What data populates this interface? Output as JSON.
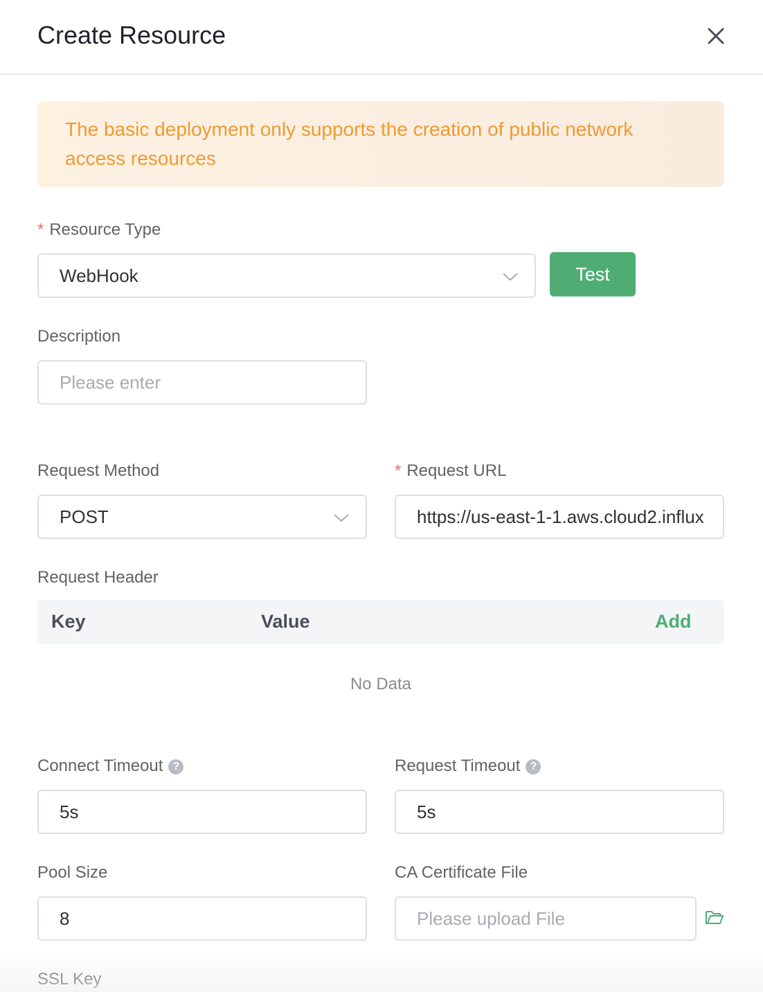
{
  "dialog": {
    "title": "Create Resource"
  },
  "alert": {
    "text": "The basic deployment only supports the creation of public network access resources"
  },
  "resource_type": {
    "label": "Resource Type",
    "required_mark": "*",
    "value": "WebHook",
    "test_label": "Test"
  },
  "description": {
    "label": "Description",
    "placeholder": "Please enter"
  },
  "request_method": {
    "label": "Request Method",
    "value": "POST"
  },
  "request_url": {
    "label": "Request URL",
    "required_mark": "*",
    "value": "https://us-east-1-1.aws.cloud2.influx"
  },
  "request_header": {
    "label": "Request Header",
    "columns": [
      "Key",
      "Value"
    ],
    "add_label": "Add",
    "empty_text": "No Data"
  },
  "connect_timeout": {
    "label": "Connect Timeout",
    "value": "5s",
    "help": "?"
  },
  "request_timeout": {
    "label": "Request Timeout",
    "value": "5s",
    "help": "?"
  },
  "pool_size": {
    "label": "Pool Size",
    "value": "8"
  },
  "ca_certificate": {
    "label": "CA Certificate File",
    "placeholder": "Please upload File",
    "icon": "folder-open-icon"
  },
  "ssl_key": {
    "label": "SSL Key"
  },
  "colors": {
    "accent": "#4fad74",
    "warning": "#ee9a33",
    "required": "#f56c6c"
  }
}
